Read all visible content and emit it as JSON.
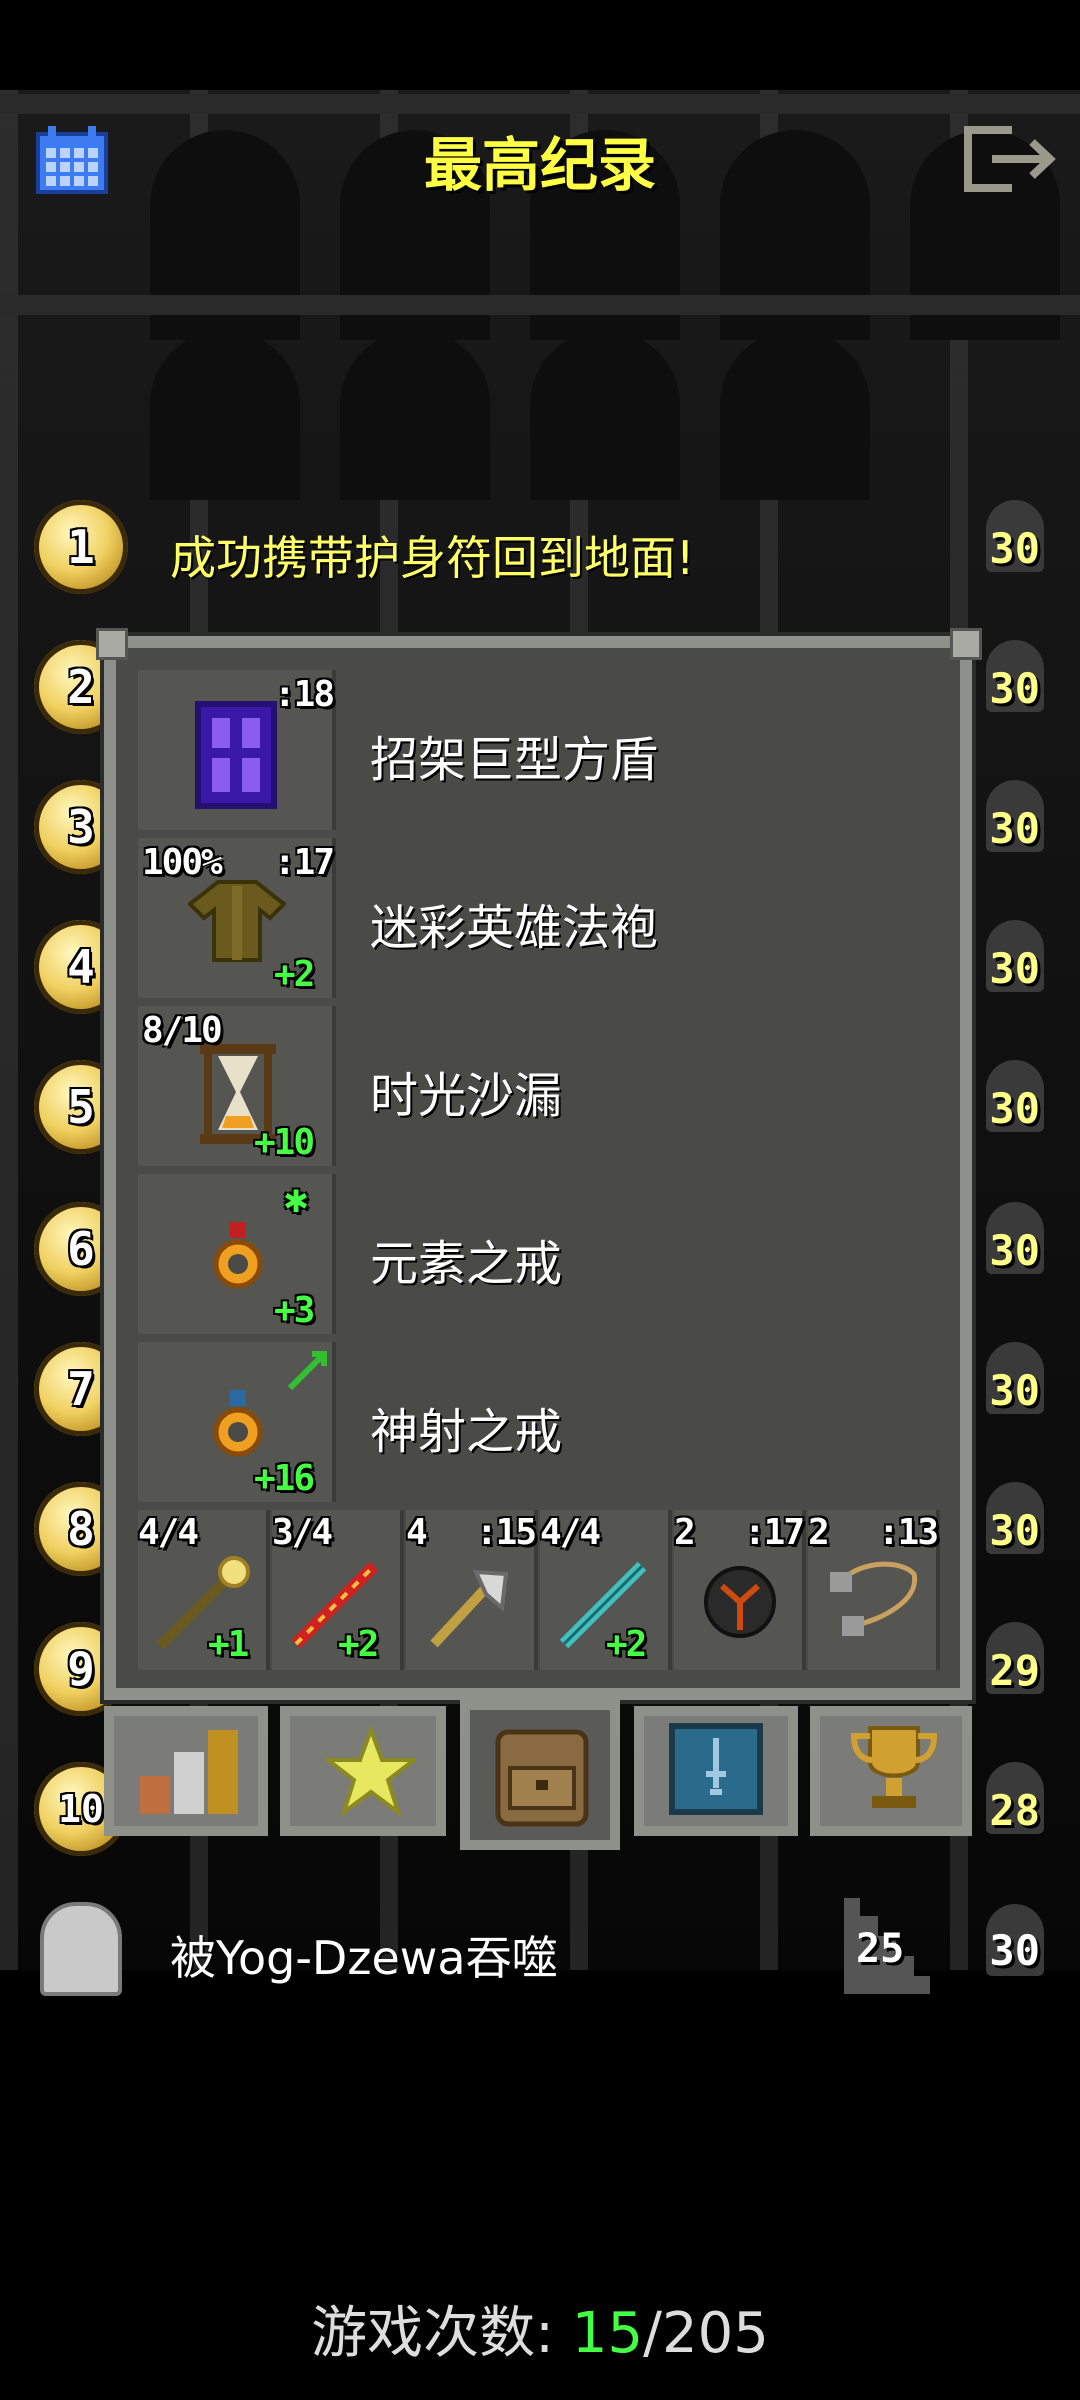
{
  "header": {
    "title": "最高纪录",
    "left_icon": "calendar-icon",
    "right_icon": "exit-icon"
  },
  "top_record": {
    "rank": "1",
    "description": "成功携带护身符回到地面!",
    "level": "30"
  },
  "ranks": [
    {
      "rank": "2",
      "level": "30"
    },
    {
      "rank": "3",
      "level": "30"
    },
    {
      "rank": "4",
      "level": "30"
    },
    {
      "rank": "5",
      "level": "30"
    },
    {
      "rank": "6",
      "level": "30"
    },
    {
      "rank": "7",
      "level": "30"
    },
    {
      "rank": "8",
      "level": "30"
    },
    {
      "rank": "9",
      "level": "29"
    },
    {
      "rank": "10",
      "level": "28"
    }
  ],
  "equipment": [
    {
      "name": "招架巨型方盾",
      "top_right": ":18",
      "top_left": "",
      "bonus": "",
      "icon": "shield-icon"
    },
    {
      "name": "迷彩英雄法袍",
      "top_right": ":17",
      "top_left": "100%",
      "bonus": "+2",
      "icon": "robe-icon"
    },
    {
      "name": "时光沙漏",
      "top_right": "",
      "top_left": "8/10",
      "bonus": "+10",
      "icon": "hourglass-icon"
    },
    {
      "name": "元素之戒",
      "top_right": "",
      "top_left": "",
      "bonus": "+3",
      "icon": "ring-icon"
    },
    {
      "name": "神射之戒",
      "top_right": "",
      "top_left": "",
      "bonus": "+16",
      "icon": "ring-icon"
    }
  ],
  "quickslots": [
    {
      "top_left": "4/4",
      "top_right": "",
      "bonus": "+1",
      "icon": "staff-icon"
    },
    {
      "top_left": "3/4",
      "top_right": "",
      "bonus": "+2",
      "icon": "wand-icon"
    },
    {
      "top_left": "4",
      "top_right": ":15",
      "bonus": "",
      "icon": "throwing-axe-icon"
    },
    {
      "top_left": "4/4",
      "top_right": "",
      "bonus": "+2",
      "icon": "wand-icon"
    },
    {
      "top_left": "2",
      "top_right": ":17",
      "bonus": "",
      "icon": "bomb-icon"
    },
    {
      "top_left": "2",
      "top_right": ":13",
      "bonus": "",
      "icon": "bolas-icon"
    }
  ],
  "tabs": [
    "stats-tab-icon",
    "talents-tab-icon",
    "inventory-tab-icon",
    "journal-tab-icon",
    "badges-tab-icon"
  ],
  "latest": {
    "description": "被Yog-Dzewa吞噬",
    "depth": "25",
    "level": "30"
  },
  "footer": {
    "label": "游戏次数:",
    "current": "15",
    "total": "/205"
  },
  "colors": {
    "title": "#ffff44",
    "bonus": "#44ff44",
    "panel": "#4a4a47",
    "panel_border": "#8e908a"
  }
}
